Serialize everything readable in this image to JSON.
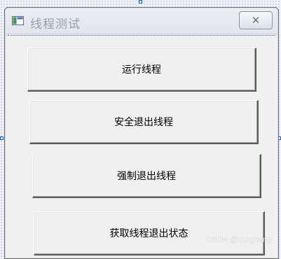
{
  "window": {
    "title": "线程测试",
    "close_label": "✕"
  },
  "buttons": [
    {
      "label": "运行线程"
    },
    {
      "label": "安全退出线程"
    },
    {
      "label": "强制退出线程"
    },
    {
      "label": "获取线程退出状态"
    }
  ],
  "watermark": "CSDN @x1ngcang",
  "colors": {
    "dialog_background": "#f0f0f0",
    "selection_handle": "#1f57c8",
    "title_text": "#9aa0aa"
  }
}
